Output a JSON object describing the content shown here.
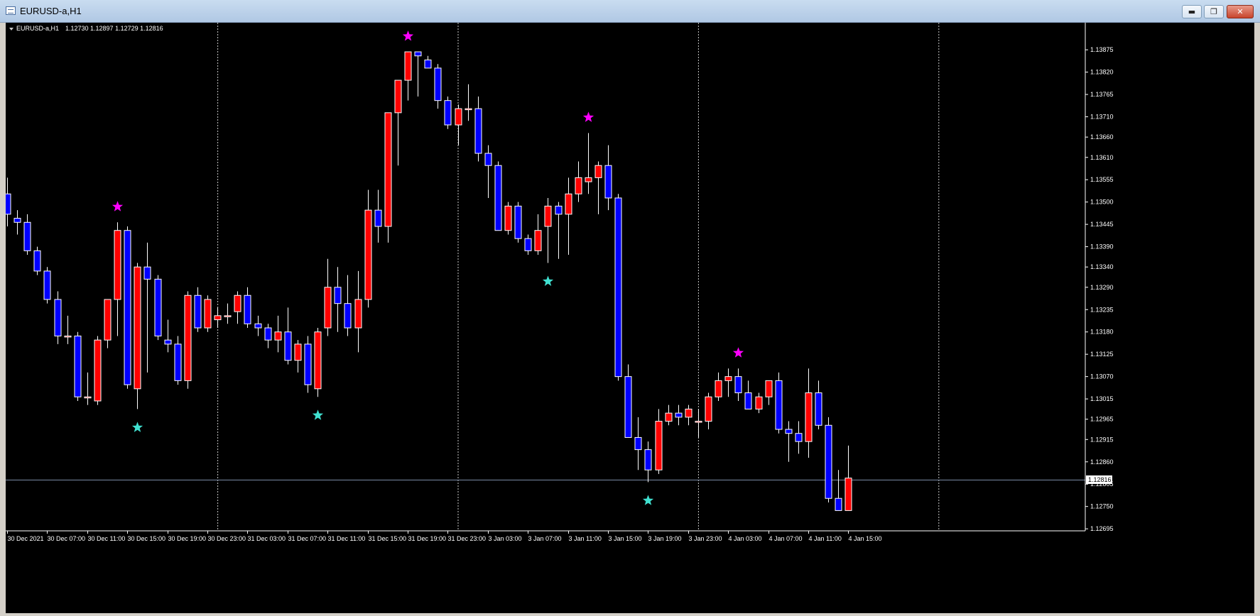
{
  "window": {
    "title": "EURUSD-a,H1",
    "minimize_label": "▬",
    "restore_label": "❐",
    "close_label": "✕"
  },
  "chart_header": {
    "symbol": "EURUSD-a,H1",
    "ohlc": "1.12730 1.12897 1.12729 1.12816"
  },
  "colors": {
    "background": "#000000",
    "bull": "#ff0000",
    "bear": "#0000ff",
    "wick": "#ffffff",
    "star_high": "#ff00ff",
    "star_low": "#40e0d0",
    "bid_line": "#7b8ea8"
  },
  "chart_data": {
    "type": "candlestick",
    "symbol": "EURUSD-a",
    "timeframe": "H1",
    "current_price": "1.12816",
    "y_ticks": [
      "1.13875",
      "1.13820",
      "1.13765",
      "1.13710",
      "1.13660",
      "1.13610",
      "1.13555",
      "1.13500",
      "1.13445",
      "1.13390",
      "1.13340",
      "1.13290",
      "1.13235",
      "1.13180",
      "1.13125",
      "1.13070",
      "1.13015",
      "1.12965",
      "1.12915",
      "1.12860",
      "1.12805",
      "1.12750",
      "1.12695"
    ],
    "ylim": [
      1.1269,
      1.1394
    ],
    "x_ticks": [
      "30 Dec 2021",
      "30 Dec 07:00",
      "30 Dec 11:00",
      "30 Dec 15:00",
      "30 Dec 19:00",
      "30 Dec 23:00",
      "31 Dec 03:00",
      "31 Dec 07:00",
      "31 Dec 11:00",
      "31 Dec 15:00",
      "31 Dec 19:00",
      "31 Dec 23:00",
      "3 Jan 03:00",
      "3 Jan 07:00",
      "3 Jan 11:00",
      "3 Jan 15:00",
      "3 Jan 19:00",
      "3 Jan 23:00",
      "4 Jan 03:00",
      "4 Jan 07:00",
      "4 Jan 11:00",
      "4 Jan 15:00"
    ],
    "candles": [
      [
        1.1352,
        1.1356,
        1.1344,
        1.1347
      ],
      [
        1.1346,
        1.1348,
        1.1342,
        1.1345
      ],
      [
        1.1345,
        1.1347,
        1.1337,
        1.1338
      ],
      [
        1.1338,
        1.1339,
        1.1332,
        1.1333
      ],
      [
        1.1333,
        1.1334,
        1.1325,
        1.1326
      ],
      [
        1.1326,
        1.1328,
        1.1315,
        1.1317
      ],
      [
        1.1317,
        1.1322,
        1.1315,
        1.1317
      ],
      [
        1.1317,
        1.1318,
        1.1301,
        1.1302
      ],
      [
        1.1302,
        1.1308,
        1.13,
        1.1302
      ],
      [
        1.1301,
        1.1317,
        1.13,
        1.1316
      ],
      [
        1.1316,
        1.1326,
        1.1314,
        1.1326
      ],
      [
        1.1326,
        1.1345,
        1.1317,
        1.1343
      ],
      [
        1.1343,
        1.1344,
        1.1304,
        1.1305
      ],
      [
        1.1304,
        1.1335,
        1.1299,
        1.1334
      ],
      [
        1.1334,
        1.134,
        1.1308,
        1.1331
      ],
      [
        1.1331,
        1.1332,
        1.1316,
        1.1317
      ],
      [
        1.1316,
        1.1321,
        1.1313,
        1.1315
      ],
      [
        1.1315,
        1.1317,
        1.1305,
        1.1306
      ],
      [
        1.1306,
        1.1328,
        1.1304,
        1.1327
      ],
      [
        1.1327,
        1.1329,
        1.1318,
        1.1319
      ],
      [
        1.1319,
        1.1327,
        1.1318,
        1.1326
      ],
      [
        1.1321,
        1.1324,
        1.1319,
        1.1322
      ],
      [
        1.1322,
        1.1325,
        1.132,
        1.1322
      ],
      [
        1.1323,
        1.1328,
        1.132,
        1.1327
      ],
      [
        1.1327,
        1.1329,
        1.1319,
        1.132
      ],
      [
        1.132,
        1.1322,
        1.1317,
        1.1319
      ],
      [
        1.1319,
        1.132,
        1.1314,
        1.1316
      ],
      [
        1.1316,
        1.1322,
        1.1313,
        1.1318
      ],
      [
        1.1318,
        1.1324,
        1.131,
        1.1311
      ],
      [
        1.1311,
        1.1316,
        1.1308,
        1.1315
      ],
      [
        1.1315,
        1.1317,
        1.1303,
        1.1305
      ],
      [
        1.1304,
        1.1319,
        1.1302,
        1.1318
      ],
      [
        1.1319,
        1.1336,
        1.1317,
        1.1329
      ],
      [
        1.1329,
        1.1334,
        1.1318,
        1.1325
      ],
      [
        1.1325,
        1.1332,
        1.1317,
        1.1319
      ],
      [
        1.1319,
        1.1333,
        1.1313,
        1.1326
      ],
      [
        1.1326,
        1.1353,
        1.1324,
        1.1348
      ],
      [
        1.1348,
        1.1353,
        1.134,
        1.1344
      ],
      [
        1.1344,
        1.1366,
        1.134,
        1.1372
      ],
      [
        1.1372,
        1.1377,
        1.1359,
        1.138
      ],
      [
        1.138,
        1.1387,
        1.1375,
        1.1387
      ],
      [
        1.1387,
        1.1387,
        1.1376,
        1.1386
      ],
      [
        1.1385,
        1.1386,
        1.1383,
        1.1383
      ],
      [
        1.1383,
        1.1384,
        1.1373,
        1.1375
      ],
      [
        1.1375,
        1.1376,
        1.1368,
        1.1369
      ],
      [
        1.1369,
        1.1374,
        1.1364,
        1.1373
      ],
      [
        1.1373,
        1.1379,
        1.137,
        1.1373
      ],
      [
        1.1373,
        1.1376,
        1.136,
        1.1362
      ],
      [
        1.1362,
        1.1364,
        1.1351,
        1.1359
      ],
      [
        1.1359,
        1.136,
        1.1343,
        1.1343
      ],
      [
        1.1343,
        1.135,
        1.1342,
        1.1349
      ],
      [
        1.1349,
        1.135,
        1.134,
        1.1341
      ],
      [
        1.1341,
        1.1342,
        1.1337,
        1.1338
      ],
      [
        1.1338,
        1.1347,
        1.1337,
        1.1343
      ],
      [
        1.1344,
        1.1351,
        1.1335,
        1.1349
      ],
      [
        1.1349,
        1.135,
        1.1336,
        1.1347
      ],
      [
        1.1347,
        1.1356,
        1.1337,
        1.1352
      ],
      [
        1.1352,
        1.136,
        1.135,
        1.1356
      ],
      [
        1.1355,
        1.1367,
        1.1352,
        1.1356
      ],
      [
        1.1356,
        1.136,
        1.1347,
        1.1359
      ],
      [
        1.1359,
        1.1364,
        1.1348,
        1.1351
      ],
      [
        1.1351,
        1.1352,
        1.1306,
        1.1307
      ],
      [
        1.1307,
        1.131,
        1.1292,
        1.1292
      ],
      [
        1.1292,
        1.1297,
        1.1284,
        1.1289
      ],
      [
        1.1289,
        1.1291,
        1.1281,
        1.1284
      ],
      [
        1.1284,
        1.1299,
        1.1283,
        1.1296
      ],
      [
        1.1296,
        1.13,
        1.1295,
        1.1298
      ],
      [
        1.1298,
        1.13,
        1.1295,
        1.1297
      ],
      [
        1.1297,
        1.13,
        1.1295,
        1.1299
      ],
      [
        1.1296,
        1.1299,
        1.1292,
        1.1296
      ],
      [
        1.1296,
        1.1303,
        1.1294,
        1.1302
      ],
      [
        1.1302,
        1.1308,
        1.1301,
        1.1306
      ],
      [
        1.1306,
        1.1309,
        1.1302,
        1.1307
      ],
      [
        1.1307,
        1.1309,
        1.1301,
        1.1303
      ],
      [
        1.1303,
        1.1306,
        1.1299,
        1.1299
      ],
      [
        1.1299,
        1.1303,
        1.1298,
        1.1302
      ],
      [
        1.1302,
        1.1306,
        1.13,
        1.1306
      ],
      [
        1.1306,
        1.1308,
        1.1293,
        1.1294
      ],
      [
        1.1294,
        1.1296,
        1.1286,
        1.1293
      ],
      [
        1.1293,
        1.1296,
        1.1288,
        1.1291
      ],
      [
        1.1291,
        1.1309,
        1.1287,
        1.1303
      ],
      [
        1.1303,
        1.1306,
        1.1294,
        1.1295
      ],
      [
        1.1295,
        1.1297,
        1.1276,
        1.1277
      ],
      [
        1.1277,
        1.1284,
        1.1274,
        1.1274
      ],
      [
        1.1274,
        1.129,
        1.1274,
        1.1282
      ]
    ],
    "markers": [
      {
        "index": 11,
        "position": "high",
        "color": "#ff00ff"
      },
      {
        "index": 13,
        "position": "low",
        "color": "#40e0d0"
      },
      {
        "index": 31,
        "position": "low",
        "color": "#40e0d0"
      },
      {
        "index": 40,
        "position": "high",
        "color": "#ff00ff"
      },
      {
        "index": 54,
        "position": "low",
        "color": "#40e0d0"
      },
      {
        "index": 58,
        "position": "high",
        "color": "#ff00ff"
      },
      {
        "index": 64,
        "position": "low",
        "color": "#40e0d0"
      },
      {
        "index": 73,
        "position": "high",
        "color": "#ff00ff"
      }
    ],
    "period_separators": true
  }
}
